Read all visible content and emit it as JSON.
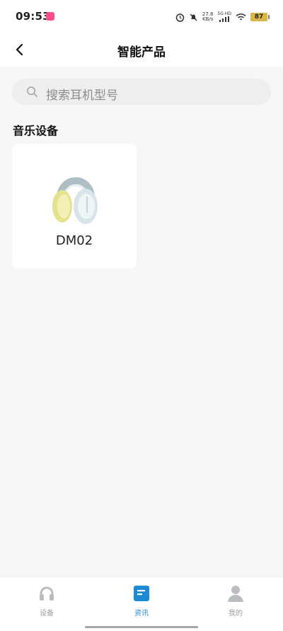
{
  "status_bar": {
    "time": "09:53",
    "network_speed": "27.8",
    "network_speed_unit": "KB/s",
    "signal_label": "5G HD",
    "battery": "87"
  },
  "header": {
    "title": "智能产品"
  },
  "search": {
    "placeholder": "搜索耳机型号"
  },
  "section": {
    "title": "音乐设备"
  },
  "products": [
    {
      "name": "DM02",
      "image": "headphones-image"
    }
  ],
  "bottom_nav": {
    "items": [
      {
        "label": "设备",
        "icon": "headphones-icon",
        "active": false
      },
      {
        "label": "资讯",
        "icon": "news-icon",
        "active": true
      },
      {
        "label": "我的",
        "icon": "profile-icon",
        "active": false
      }
    ]
  },
  "colors": {
    "accent": "#1d8ad6",
    "background": "#f7f7f7",
    "card": "#ffffff",
    "search_background": "#eeeeee",
    "battery": "#d9b646"
  }
}
